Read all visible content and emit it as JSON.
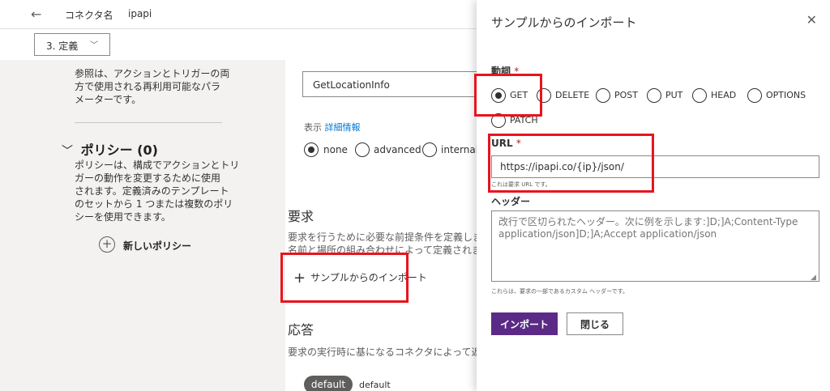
{
  "topbar": {
    "back_icon": "arrow-left-icon",
    "connector_label": "コネクタ名",
    "connector_name": "ipapi"
  },
  "stepbar": {
    "step_label": "3. 定義",
    "chevron": "﹀"
  },
  "leftpanel": {
    "params_desc": [
      "参照は、アクションとトリガーの両",
      "方で使用される再利用可能なパラ",
      "メーターです。"
    ],
    "policy_title": "ポリシー (0)",
    "policy_chevron": "﹀",
    "policy_desc": [
      "ポリシーは、構成でアクションとトリ",
      "ガーの動作を変更するために使用",
      "されます。定義済みのテンプレート",
      "のセットから 1 つまたは複数のポリ",
      "シーを使用できます。"
    ],
    "add_icon": "+",
    "add_policy_label": "新しいポリシー"
  },
  "maincard": {
    "operation_id": "GetLocationInfo",
    "visibility_label": "表示",
    "visibility_link": "詳細情報",
    "visibility_options": [
      "none",
      "advanced",
      "internal"
    ]
  },
  "request": {
    "title": "要求",
    "desc": [
      "要求を行うために必要な前提条件を定義しま",
      "名前と場所の組み合わせによって定義されま"
    ],
    "import_icon": "+",
    "import_label": "サンプルからのインポート"
  },
  "response": {
    "title": "応答",
    "desc": "要求の実行時に基になるコネクタによって返さ",
    "default_badge": "default",
    "default_text": "default"
  },
  "panel": {
    "title": "サンプルからのインポート",
    "close_icon": "✕",
    "verb_label": "動詞",
    "required_mark": "*",
    "verbs": [
      "GET",
      "DELETE",
      "POST",
      "PUT",
      "HEAD",
      "OPTIONS",
      "PATCH"
    ],
    "selected_verb": "GET",
    "url_label": "URL",
    "url_value": "https://ipapi.co/{ip}/json/",
    "url_hint": "これは要求 URL です。",
    "headers_label": "ヘッダー",
    "headers_placeholder": "改行で区切られたヘッダー。次に例を示します:]D;]A;Content-Type application/json]D;]A;Accept application/json",
    "headers_hint": "これらは、要求の一部であるカスタム ヘッダーです。",
    "import_button": "インポート",
    "close_button": "閉じる"
  },
  "colors": {
    "accent": "#5b2a86",
    "highlight": "#e8141d"
  }
}
